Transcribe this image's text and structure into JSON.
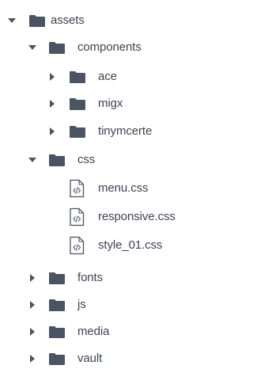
{
  "tree": {
    "assets": {
      "label": "assets",
      "icon": "folder-icon",
      "state": "expanded"
    },
    "components": {
      "label": "components",
      "icon": "folder-icon",
      "state": "expanded"
    },
    "ace": {
      "label": "ace",
      "icon": "folder-icon",
      "state": "collapsed"
    },
    "migx": {
      "label": "migx",
      "icon": "folder-icon",
      "state": "collapsed"
    },
    "tinymcerte": {
      "label": "tinymcerte",
      "icon": "folder-icon",
      "state": "collapsed"
    },
    "css": {
      "label": "css",
      "icon": "folder-icon",
      "state": "expanded"
    },
    "menu_css": {
      "label": "menu.css",
      "icon": "css-file-icon"
    },
    "responsive_css": {
      "label": "responsive.css",
      "icon": "css-file-icon"
    },
    "style_01_css": {
      "label": "style_01.css",
      "icon": "css-file-icon"
    },
    "fonts": {
      "label": "fonts",
      "icon": "folder-icon",
      "state": "collapsed"
    },
    "js": {
      "label": "js",
      "icon": "folder-icon",
      "state": "collapsed"
    },
    "media": {
      "label": "media",
      "icon": "folder-icon",
      "state": "collapsed"
    },
    "vault": {
      "label": "vault",
      "icon": "folder-icon",
      "state": "collapsed"
    }
  },
  "colors": {
    "text": "#3b4554",
    "icon": "#4a5463",
    "background": "#ffffff"
  }
}
